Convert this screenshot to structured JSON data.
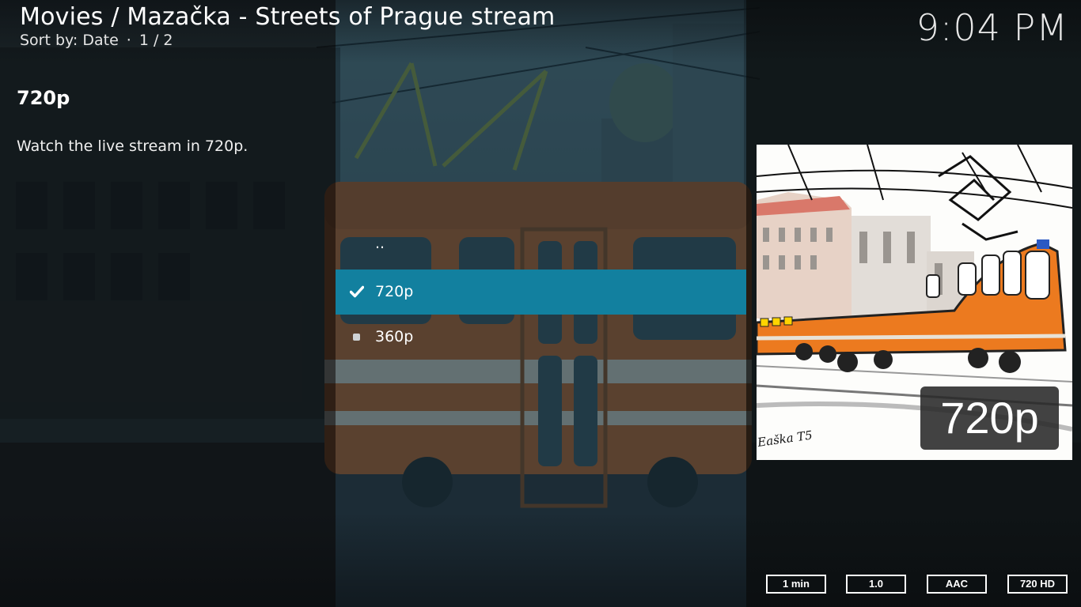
{
  "header": {
    "title": "Movies / Mazačka - Streets of Prague stream",
    "sort_label": "Sort by: Date",
    "separator": "·",
    "page_counter": "1 / 2",
    "clock": "9:04 PM"
  },
  "info": {
    "title": "720p",
    "description": "Watch the live stream in 720p."
  },
  "list": {
    "parent_label": "..",
    "items": [
      {
        "label": "720p",
        "state": "selected",
        "icon": "check-icon"
      },
      {
        "label": "360p",
        "state": "normal",
        "icon": "bullet-icon"
      }
    ]
  },
  "poster": {
    "badge_text": "720p",
    "signature": "Eaška T5"
  },
  "flags": [
    "1 min",
    "1.0",
    "AAC",
    "720 HD"
  ],
  "colors": {
    "selection": "#12809f",
    "tram_orange": "#e8731e"
  }
}
